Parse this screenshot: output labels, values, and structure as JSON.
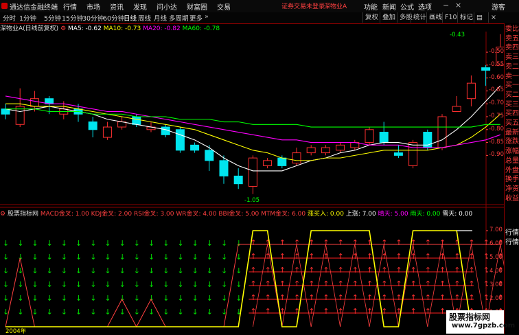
{
  "titlebar": {
    "app_name": "通达信金融终端",
    "menus": [
      "行情",
      "市场",
      "资讯",
      "发现",
      "问小达",
      "财富圈",
      "交易"
    ],
    "warn": "证券交易未登录",
    "stock_short": "深物业A",
    "right": [
      "功能",
      "新闻",
      "公式",
      "选项"
    ],
    "guest": "游客"
  },
  "toolbar": {
    "periods": [
      "分时",
      "1分钟",
      "5分钟",
      "15分钟",
      "30分钟",
      "60分钟",
      "日线",
      "周线",
      "月线",
      "多周期",
      "更多"
    ],
    "active_period": "日线",
    "tools": [
      "复权",
      "叠加",
      "多股",
      "统计",
      "画线",
      "F10",
      "标记"
    ]
  },
  "info_main": {
    "label": "深物业A(日线前复权)",
    "ma5": "MA5: -0.62",
    "ma10": "MA10: -0.73",
    "ma20": "MA20: -0.82",
    "ma60": "MA60: -0.78",
    "colors": {
      "ma5": "#ffffff",
      "ma10": "#ffff00",
      "ma20": "#ff00ff",
      "ma60": "#00ff00"
    }
  },
  "price_axis": [
    "-0.50",
    "-0.55",
    "-0.60",
    "-0.65",
    "-0.70",
    "-0.75",
    "-0.80",
    "-0.85",
    "-0.90"
  ],
  "high_label": "-0.43",
  "low_label": "-1.05",
  "info_ind": {
    "name": "股票指标网",
    "items": [
      {
        "t": "MACD金叉: 1.00",
        "c": "#ff4040"
      },
      {
        "t": "KDJ金叉: 2.00",
        "c": "#ff4040"
      },
      {
        "t": "RSI金叉: 3.00",
        "c": "#ff4040"
      },
      {
        "t": "WR金叉: 4.00",
        "c": "#ff4040"
      },
      {
        "t": "BBI金叉: 5.00",
        "c": "#ff4040"
      },
      {
        "t": "MTM金叉: 6.00",
        "c": "#ff4040"
      },
      {
        "t": "涨买入: 0.00",
        "c": "#ffff00"
      },
      {
        "t": "上涨: 7.00",
        "c": "#ffffff"
      },
      {
        "t": "晴天: 5.00",
        "c": "#ff00ff"
      },
      {
        "t": "雨天: 0.00",
        "c": "#00ff00"
      },
      {
        "t": "雪天: 0.00",
        "c": "#ffffff"
      }
    ]
  },
  "ind_axis": [
    "7.00",
    "6.00",
    "5.00",
    "4.00",
    "3.00",
    "2.00",
    "1.00"
  ],
  "sidebar": [
    "委比",
    "卖五",
    "卖四",
    "卖三",
    "卖二",
    "卖一",
    "买一",
    "买二",
    "买三",
    "买四",
    "买五",
    "最新",
    "涨跌",
    "涨幅",
    "总量",
    "外盘",
    "换手",
    "净资",
    "收益"
  ],
  "sidebar2": [
    "行情",
    "行情"
  ],
  "bottom": {
    "year": "2004年"
  },
  "watermark": {
    "line1": "股票指标网",
    "line2": "www.7gpzb.com"
  },
  "chart_data": {
    "type": "candlestick",
    "ylim": [
      -1.08,
      -0.42
    ],
    "candles": [
      {
        "o": -0.72,
        "c": -0.74,
        "h": -0.7,
        "l": -0.76
      },
      {
        "o": -0.78,
        "c": -0.71,
        "h": -0.64,
        "l": -0.79
      },
      {
        "o": -0.71,
        "c": -0.68,
        "h": -0.65,
        "l": -0.73
      },
      {
        "o": -0.68,
        "c": -0.7,
        "h": -0.67,
        "l": -0.74
      },
      {
        "o": -0.74,
        "c": -0.72,
        "h": -0.69,
        "l": -0.76
      },
      {
        "o": -0.72,
        "c": -0.74,
        "h": -0.7,
        "l": -0.77
      },
      {
        "o": -0.77,
        "c": -0.8,
        "h": -0.75,
        "l": -0.83
      },
      {
        "o": -0.83,
        "c": -0.79,
        "h": -0.77,
        "l": -0.84
      },
      {
        "o": -0.79,
        "c": -0.77,
        "h": -0.75,
        "l": -0.8
      },
      {
        "o": -0.75,
        "c": -0.78,
        "h": -0.74,
        "l": -0.79
      },
      {
        "o": -0.8,
        "c": -0.79,
        "h": -0.77,
        "l": -0.81
      },
      {
        "o": -0.79,
        "c": -0.82,
        "h": -0.78,
        "l": -0.83
      },
      {
        "o": -0.8,
        "c": -0.88,
        "h": -0.79,
        "l": -0.89
      },
      {
        "o": -0.86,
        "c": -0.88,
        "h": -0.85,
        "l": -0.89
      },
      {
        "o": -0.88,
        "c": -0.92,
        "h": -0.86,
        "l": -0.96
      },
      {
        "o": -0.92,
        "c": -0.98,
        "h": -0.9,
        "l": -1.01
      },
      {
        "o": -0.98,
        "c": -1.01,
        "h": -0.95,
        "l": -1.03
      },
      {
        "o": -1.02,
        "c": -0.91,
        "h": -0.9,
        "l": -1.05
      },
      {
        "o": -0.94,
        "c": -0.92,
        "h": -0.91,
        "l": -0.95
      },
      {
        "o": -0.91,
        "c": -0.94,
        "h": -0.9,
        "l": -0.95
      },
      {
        "o": -0.93,
        "c": -0.89,
        "h": -0.87,
        "l": -0.94
      },
      {
        "o": -0.89,
        "c": -0.87,
        "h": -0.86,
        "l": -0.9
      },
      {
        "o": -0.89,
        "c": -0.87,
        "h": -0.86,
        "l": -0.9
      },
      {
        "o": -0.88,
        "c": -0.86,
        "h": -0.85,
        "l": -0.89
      },
      {
        "o": -0.87,
        "c": -0.85,
        "h": -0.84,
        "l": -0.88
      },
      {
        "o": -0.85,
        "c": -0.8,
        "h": -0.79,
        "l": -0.86
      },
      {
        "o": -0.81,
        "c": -0.85,
        "h": -0.77,
        "l": -0.86
      },
      {
        "o": -0.89,
        "c": -0.9,
        "h": -0.86,
        "l": -0.91
      },
      {
        "o": -0.94,
        "c": -0.85,
        "h": -0.84,
        "l": -0.95
      },
      {
        "o": -0.81,
        "c": -0.87,
        "h": -0.8,
        "l": -0.88
      },
      {
        "o": -0.87,
        "c": -0.75,
        "h": -0.74,
        "l": -0.88
      },
      {
        "o": -0.73,
        "c": -0.71,
        "h": -0.67,
        "l": -0.73
      },
      {
        "o": -0.68,
        "c": -0.62,
        "h": -0.59,
        "l": -0.71
      },
      {
        "o": -0.56,
        "c": -0.57,
        "h": -0.55,
        "l": -0.63
      },
      {
        "o": -0.55,
        "c": -0.48,
        "h": -0.43,
        "l": -0.55
      }
    ],
    "ma5": [
      -0.72,
      -0.73,
      -0.72,
      -0.71,
      -0.72,
      -0.73,
      -0.74,
      -0.76,
      -0.77,
      -0.78,
      -0.79,
      -0.8,
      -0.82,
      -0.84,
      -0.87,
      -0.91,
      -0.94,
      -0.96,
      -0.96,
      -0.96,
      -0.94,
      -0.92,
      -0.91,
      -0.89,
      -0.88,
      -0.86,
      -0.85,
      -0.85,
      -0.86,
      -0.86,
      -0.84,
      -0.8,
      -0.75,
      -0.69,
      -0.63
    ],
    "ma10": [
      -0.7,
      -0.7,
      -0.71,
      -0.71,
      -0.71,
      -0.72,
      -0.73,
      -0.74,
      -0.75,
      -0.76,
      -0.77,
      -0.78,
      -0.79,
      -0.8,
      -0.82,
      -0.84,
      -0.86,
      -0.88,
      -0.89,
      -0.91,
      -0.92,
      -0.92,
      -0.91,
      -0.91,
      -0.9,
      -0.89,
      -0.88,
      -0.88,
      -0.88,
      -0.88,
      -0.87,
      -0.86,
      -0.83,
      -0.79,
      -0.74
    ],
    "ma20": [
      -0.67,
      -0.68,
      -0.69,
      -0.7,
      -0.7,
      -0.71,
      -0.72,
      -0.73,
      -0.73,
      -0.74,
      -0.75,
      -0.76,
      -0.77,
      -0.78,
      -0.79,
      -0.8,
      -0.81,
      -0.82,
      -0.83,
      -0.84,
      -0.84,
      -0.85,
      -0.85,
      -0.85,
      -0.85,
      -0.86,
      -0.86,
      -0.86,
      -0.87,
      -0.87,
      -0.87,
      -0.86,
      -0.85,
      -0.84,
      -0.82
    ],
    "ma60": [
      -0.72,
      -0.72,
      -0.72,
      -0.73,
      -0.73,
      -0.73,
      -0.74,
      -0.74,
      -0.74,
      -0.75,
      -0.75,
      -0.75,
      -0.76,
      -0.76,
      -0.76,
      -0.77,
      -0.77,
      -0.78,
      -0.78,
      -0.78,
      -0.78,
      -0.79,
      -0.79,
      -0.79,
      -0.79,
      -0.79,
      -0.79,
      -0.79,
      -0.79,
      -0.79,
      -0.79,
      -0.79,
      -0.79,
      -0.78,
      -0.78
    ],
    "indicator": {
      "ylim": [
        0,
        8
      ],
      "rise": [
        0,
        0,
        0,
        0,
        0,
        0,
        0,
        0,
        0,
        0,
        0,
        0,
        0,
        0,
        0,
        0,
        0,
        7,
        7,
        0,
        0,
        7,
        7,
        7,
        7,
        7,
        0,
        0,
        7,
        7,
        7,
        7,
        0,
        0,
        0
      ],
      "signals": [
        0,
        5,
        0,
        0,
        0,
        0,
        0,
        0,
        2,
        0,
        2,
        0,
        0,
        0,
        0,
        0,
        6,
        6,
        6,
        6,
        6,
        6,
        6,
        6,
        6,
        6,
        6,
        6,
        6,
        6,
        6,
        6,
        6,
        6,
        6
      ],
      "arrows_green_levels": [
        1,
        2,
        3,
        4,
        5,
        6
      ],
      "arrows_red_levels": [
        1,
        2,
        3,
        4,
        5,
        6
      ]
    }
  }
}
